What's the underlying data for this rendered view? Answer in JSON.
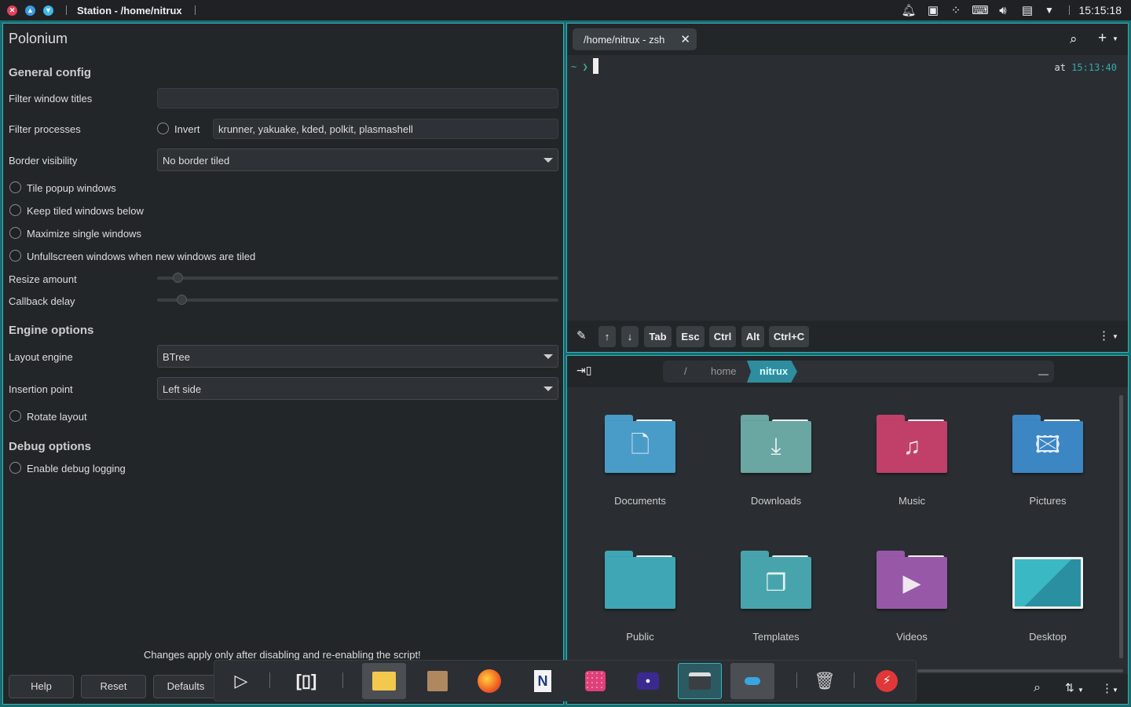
{
  "topbar": {
    "title": "Station - /home/nitrux",
    "clock": "15:15:18",
    "window_buttons": [
      "close",
      "minimize",
      "maximize"
    ],
    "tray_icons": [
      "bell-icon",
      "twitch-icon",
      "network-icon",
      "keyboard-icon",
      "volume-icon",
      "clipboard-icon",
      "chevron-down-icon"
    ]
  },
  "polonium": {
    "title": "Polonium",
    "general_header": "General config",
    "filter_titles_label": "Filter window titles",
    "filter_titles_value": "",
    "filter_processes_label": "Filter processes",
    "invert_label": "Invert",
    "filter_processes_value": "krunner, yakuake, kded, polkit, plasmashell",
    "border_label": "Border visibility",
    "border_value": "No border tiled",
    "tile_popup": "Tile popup windows",
    "keep_below": "Keep tiled windows below",
    "maximize_single": "Maximize single windows",
    "unfullscreen": "Unfullscreen windows when new windows are tiled",
    "resize_label": "Resize amount",
    "resize_value": 0.05,
    "callback_label": "Callback delay",
    "callback_value": 0.06,
    "engine_header": "Engine options",
    "layout_label": "Layout engine",
    "layout_value": "BTree",
    "insertion_label": "Insertion point",
    "insertion_value": "Left side",
    "rotate_label": "Rotate layout",
    "debug_header": "Debug options",
    "debug_label": "Enable debug logging",
    "notice": "Changes apply only after disabling and re-enabling the script!",
    "help": "Help",
    "reset": "Reset",
    "defaults": "Defaults"
  },
  "terminal": {
    "tab_label": "/home/nitrux - zsh",
    "prompt": "~ ❯",
    "time_prefix": "at",
    "time": "15:13:40",
    "keys": [
      "↑",
      "↓",
      "Tab",
      "Esc",
      "Ctrl",
      "Alt",
      "Ctrl+C"
    ]
  },
  "files": {
    "crumb_root": "/",
    "crumb_home": "home",
    "crumb_current": "nitrux",
    "folders": [
      {
        "name": "Documents",
        "color": "#4a9cc8",
        "icon": "document-icon"
      },
      {
        "name": "Downloads",
        "color": "#6aa6a2",
        "icon": "download-icon"
      },
      {
        "name": "Music",
        "color": "#c0406a",
        "icon": "music-icon"
      },
      {
        "name": "Pictures",
        "color": "#3c86c4",
        "icon": "image-icon"
      },
      {
        "name": "Public",
        "color": "#3ea6b4",
        "icon": "folder-icon"
      },
      {
        "name": "Templates",
        "color": "#48a4ac",
        "icon": "template-icon"
      },
      {
        "name": "Videos",
        "color": "#9858a8",
        "icon": "video-icon"
      },
      {
        "name": "Desktop",
        "color": "#2aa7b2",
        "icon": "desktop-icon"
      }
    ]
  },
  "dock": {
    "items": [
      "play-icon",
      "overview-icon",
      "files-icon",
      "archive-icon",
      "firefox-icon",
      "notes-icon",
      "launcher-icon",
      "media-player-icon",
      "terminal-icon",
      "settings-icon",
      "trash-icon",
      "power-icon"
    ]
  },
  "colors": {
    "accent": "#2fb8b8",
    "panel": "#232629",
    "background": "#1b6a72"
  }
}
